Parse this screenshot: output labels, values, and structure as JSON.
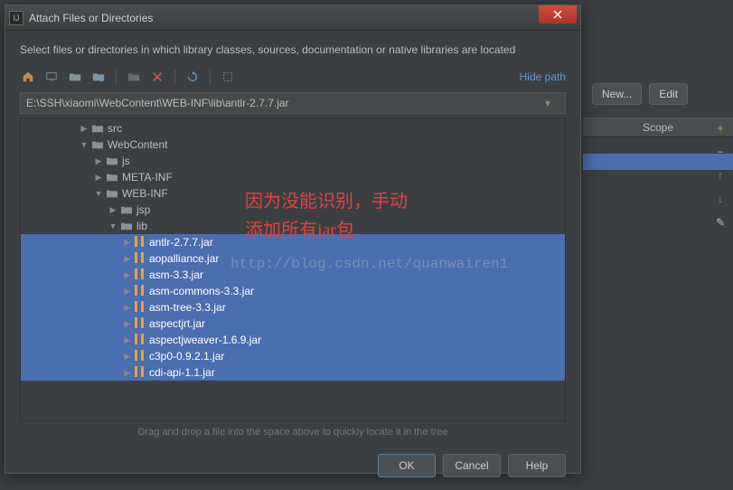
{
  "dialog": {
    "title": "Attach Files or Directories",
    "instruction": "Select files or directories in which library classes, sources, documentation or native libraries are located",
    "hide_path": "Hide path",
    "path": "E:\\SSH\\xiaomi\\WebContent\\WEB-INF\\lib\\antlr-2.7.7.jar",
    "hint": "Drag and drop a file into the space above to quickly locate it in the tree",
    "buttons": {
      "ok": "OK",
      "cancel": "Cancel",
      "help": "Help"
    }
  },
  "tree": [
    {
      "indent": 4,
      "arrow": "right",
      "type": "folder",
      "label": "src",
      "selected": false
    },
    {
      "indent": 4,
      "arrow": "down",
      "type": "folder",
      "label": "WebContent",
      "selected": false
    },
    {
      "indent": 5,
      "arrow": "right",
      "type": "folder",
      "label": "js",
      "selected": false
    },
    {
      "indent": 5,
      "arrow": "right",
      "type": "folder",
      "label": "META-INF",
      "selected": false
    },
    {
      "indent": 5,
      "arrow": "down",
      "type": "folder",
      "label": "WEB-INF",
      "selected": false
    },
    {
      "indent": 6,
      "arrow": "right",
      "type": "folder",
      "label": "jsp",
      "selected": false
    },
    {
      "indent": 6,
      "arrow": "down",
      "type": "folder",
      "label": "lib",
      "selected": false
    },
    {
      "indent": 7,
      "arrow": "right",
      "type": "jar",
      "label": "antlr-2.7.7.jar",
      "selected": true
    },
    {
      "indent": 7,
      "arrow": "right",
      "type": "jar",
      "label": "aopalliance.jar",
      "selected": true
    },
    {
      "indent": 7,
      "arrow": "right",
      "type": "jar",
      "label": "asm-3.3.jar",
      "selected": true
    },
    {
      "indent": 7,
      "arrow": "right",
      "type": "jar",
      "label": "asm-commons-3.3.jar",
      "selected": true
    },
    {
      "indent": 7,
      "arrow": "right",
      "type": "jar",
      "label": "asm-tree-3.3.jar",
      "selected": true
    },
    {
      "indent": 7,
      "arrow": "right",
      "type": "jar",
      "label": "aspectjrt.jar",
      "selected": true
    },
    {
      "indent": 7,
      "arrow": "right",
      "type": "jar",
      "label": "aspectjweaver-1.6.9.jar",
      "selected": true
    },
    {
      "indent": 7,
      "arrow": "right",
      "type": "jar",
      "label": "c3p0-0.9.2.1.jar",
      "selected": true
    },
    {
      "indent": 7,
      "arrow": "right",
      "type": "jar",
      "label": "cdi-api-1.1.jar",
      "selected": true
    }
  ],
  "back": {
    "new": "New...",
    "edit": "Edit",
    "scope": "Scope"
  },
  "overlay": {
    "line1": "因为没能识别，手动",
    "line2": "添加所有jar包",
    "watermark": "http://blog.csdn.net/quanwairen1"
  },
  "colors": {
    "selection": "#4b6eaf",
    "accent_red": "#e04040"
  }
}
